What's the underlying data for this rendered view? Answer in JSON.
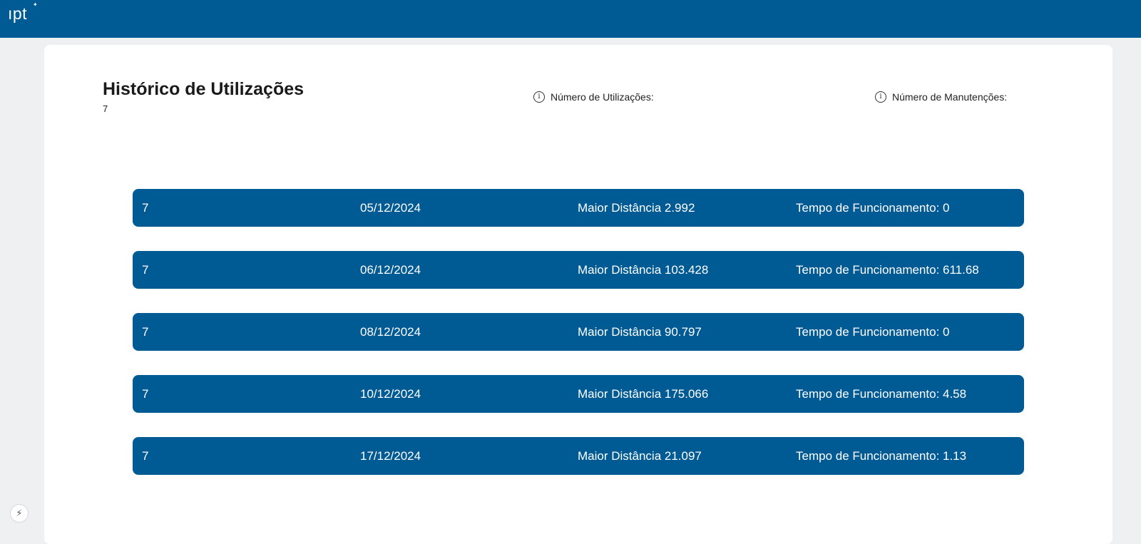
{
  "header": {
    "logo_text": "ıpt",
    "logo_mark": "✦"
  },
  "page": {
    "title": "Histórico de Utilizações",
    "count": "7",
    "stat_usages_label": "Número de Utilizações:",
    "stat_maintenance_label": "Número de Manutenções:"
  },
  "rows": [
    {
      "id": "7",
      "date": "05/12/2024",
      "distance": "Maior Distância 2.992",
      "runtime": "Tempo de Funcionamento: 0"
    },
    {
      "id": "7",
      "date": "06/12/2024",
      "distance": "Maior Distância 103.428",
      "runtime": "Tempo de Funcionamento: 611.68"
    },
    {
      "id": "7",
      "date": "08/12/2024",
      "distance": "Maior Distância 90.797",
      "runtime": "Tempo de Funcionamento: 0"
    },
    {
      "id": "7",
      "date": "10/12/2024",
      "distance": "Maior Distância 175.066",
      "runtime": "Tempo de Funcionamento: 4.58"
    },
    {
      "id": "7",
      "date": "17/12/2024",
      "distance": "Maior Distância 21.097",
      "runtime": "Tempo de Funcionamento: 1.13"
    }
  ],
  "icons": {
    "info": "info-icon",
    "bolt": "bolt-icon"
  },
  "colors": {
    "brand": "#005a93",
    "background": "#eef0f2",
    "card": "#ffffff"
  }
}
